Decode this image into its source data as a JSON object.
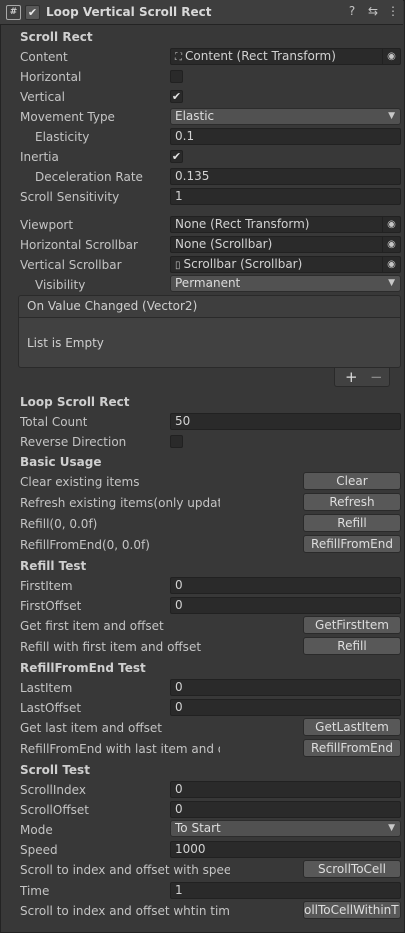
{
  "header": {
    "script_icon": "#",
    "enabled_check": "✔",
    "title": "Loop Vertical Scroll Rect",
    "help_icon": "?",
    "settings_icon": "⇆",
    "menu_icon": "⋮"
  },
  "scroll_rect": {
    "section": "Scroll Rect",
    "content_label": "Content",
    "content_value": "Content (Rect Transform)",
    "horizontal_label": "Horizontal",
    "horizontal_checked": "",
    "vertical_label": "Vertical",
    "vertical_checked": "✔",
    "movement_label": "Movement Type",
    "movement_value": "Elastic",
    "elasticity_label": "Elasticity",
    "elasticity_value": "0.1",
    "inertia_label": "Inertia",
    "inertia_checked": "✔",
    "deceleration_label": "Deceleration Rate",
    "deceleration_value": "0.135",
    "sensitivity_label": "Scroll Sensitivity",
    "sensitivity_value": "1",
    "viewport_label": "Viewport",
    "viewport_value": "None (Rect Transform)",
    "hscroll_label": "Horizontal Scrollbar",
    "hscroll_value": "None (Scrollbar)",
    "vscroll_label": "Vertical Scrollbar",
    "vscroll_value": "Scrollbar (Scrollbar)",
    "visibility_label": "Visibility",
    "visibility_value": "Permanent",
    "event_title": "On Value Changed (Vector2)",
    "event_empty": "List is Empty",
    "event_add": "+",
    "event_remove": "−"
  },
  "loop": {
    "section": "Loop Scroll Rect",
    "total_label": "Total Count",
    "total_value": "50",
    "reverse_label": "Reverse Direction",
    "reverse_checked": ""
  },
  "basic": {
    "section": "Basic Usage",
    "clear_label": "Clear existing items",
    "clear_btn": "Clear",
    "refresh_label": "Refresh existing items(only update d",
    "refresh_btn": "Refresh",
    "refill_label": "Refill(0, 0.0f)",
    "refill_btn": "Refill",
    "refill_end_label": "RefillFromEnd(0, 0.0f)",
    "refill_end_btn": "RefillFromEnd"
  },
  "refill_test": {
    "section": "Refill Test",
    "first_item_label": "FirstItem",
    "first_item_value": "0",
    "first_offset_label": "FirstOffset",
    "first_offset_value": "0",
    "get_first_label": "Get first item and offset",
    "get_first_btn": "GetFirstItem",
    "refill_first_label": "Refill with first item and offset",
    "refill_first_btn": "Refill"
  },
  "refill_end_test": {
    "section": "RefillFromEnd Test",
    "last_item_label": "LastItem",
    "last_item_value": "0",
    "last_offset_label": "LastOffset",
    "last_offset_value": "0",
    "get_last_label": "Get last item and offset",
    "get_last_btn": "GetLastItem",
    "refill_last_label": "RefillFromEnd with last item and offs",
    "refill_last_btn": "RefillFromEnd"
  },
  "scroll_test": {
    "section": "Scroll Test",
    "index_label": "ScrollIndex",
    "index_value": "0",
    "offset_label": "ScrollOffset",
    "offset_value": "0",
    "mode_label": "Mode",
    "mode_value": "To Start",
    "speed_label": "Speed",
    "speed_value": "1000",
    "scroll_speed_label": "Scroll to index and offset with speed",
    "scroll_speed_btn": "ScrollToCell",
    "time_label": "Time",
    "time_value": "1",
    "scroll_time_label": "Scroll to index and offset whtin time",
    "scroll_time_btn": "ollToCellWithinT"
  }
}
